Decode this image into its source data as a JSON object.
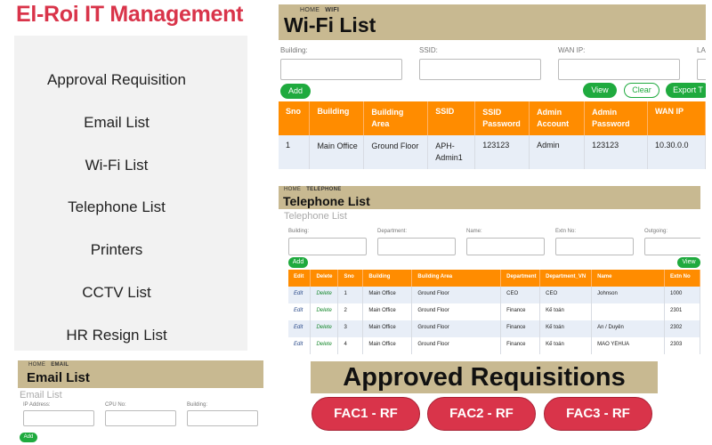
{
  "brand": "El-Roi  IT Management",
  "nav": [
    "Approval Requisition",
    "Email List",
    "Wi-Fi List",
    "Telephone List",
    "Printers",
    "CCTV List",
    "HR Resign List"
  ],
  "wifi": {
    "crumb_home": "HOME",
    "crumb_current": "WIFI",
    "title": "Wi-Fi List",
    "filters": [
      "Building:",
      "SSID:",
      "WAN IP:",
      "LA"
    ],
    "add": "Add",
    "view": "View",
    "clear": "Clear",
    "export": "Export T",
    "columns": [
      "Sno",
      "Building",
      "Building Area",
      "SSID",
      "SSID Password",
      "Admin Account",
      "Admin Password",
      "WAN IP"
    ],
    "rows": [
      [
        "1",
        "Main Office",
        "Ground Floor",
        "APH-Admin1",
        "123123",
        "Admin",
        "123123",
        "10.30.0.0"
      ]
    ]
  },
  "telephone": {
    "crumb_home": "HOME",
    "crumb_current": "TELEPHONE",
    "title": "Telephone List",
    "subtitle": "Telephone List",
    "filters": [
      "Building:",
      "Department:",
      "Name:",
      "Extn No:",
      "Outgoing:"
    ],
    "add": "Add",
    "view": "View",
    "columns": [
      "Edit",
      "Delete",
      "Sno",
      "Building",
      "Building Area",
      "Department",
      "Department_VN",
      "Name",
      "Extn No"
    ],
    "rows": [
      [
        "Edit",
        "Delete",
        "1",
        "Main Office",
        "Ground Floor",
        "CEO",
        "CEO",
        "Johnson",
        "1000"
      ],
      [
        "Edit",
        "Delete",
        "2",
        "Main Office",
        "Ground Floor",
        "Finance",
        "Kế toán",
        "",
        "2301"
      ],
      [
        "Edit",
        "Delete",
        "3",
        "Main Office",
        "Ground Floor",
        "Finance",
        "Kế toán",
        "An / Duyên",
        "2302"
      ],
      [
        "Edit",
        "Delete",
        "4",
        "Main Office",
        "Ground Floor",
        "Finance",
        "Kế toán",
        "MAO YEHUA",
        "2303"
      ]
    ]
  },
  "email": {
    "crumb_home": "HOME",
    "crumb_current": "EMAIL",
    "title": "Email List",
    "subtitle": "Email List",
    "filters": [
      "IP Address:",
      "CPU No:",
      "Building:"
    ],
    "add": "Add"
  },
  "approved": {
    "title": "Approved Requisitions",
    "buttons": [
      "FAC1 - RF",
      "FAC2 - RF",
      "FAC3 - RF"
    ]
  }
}
